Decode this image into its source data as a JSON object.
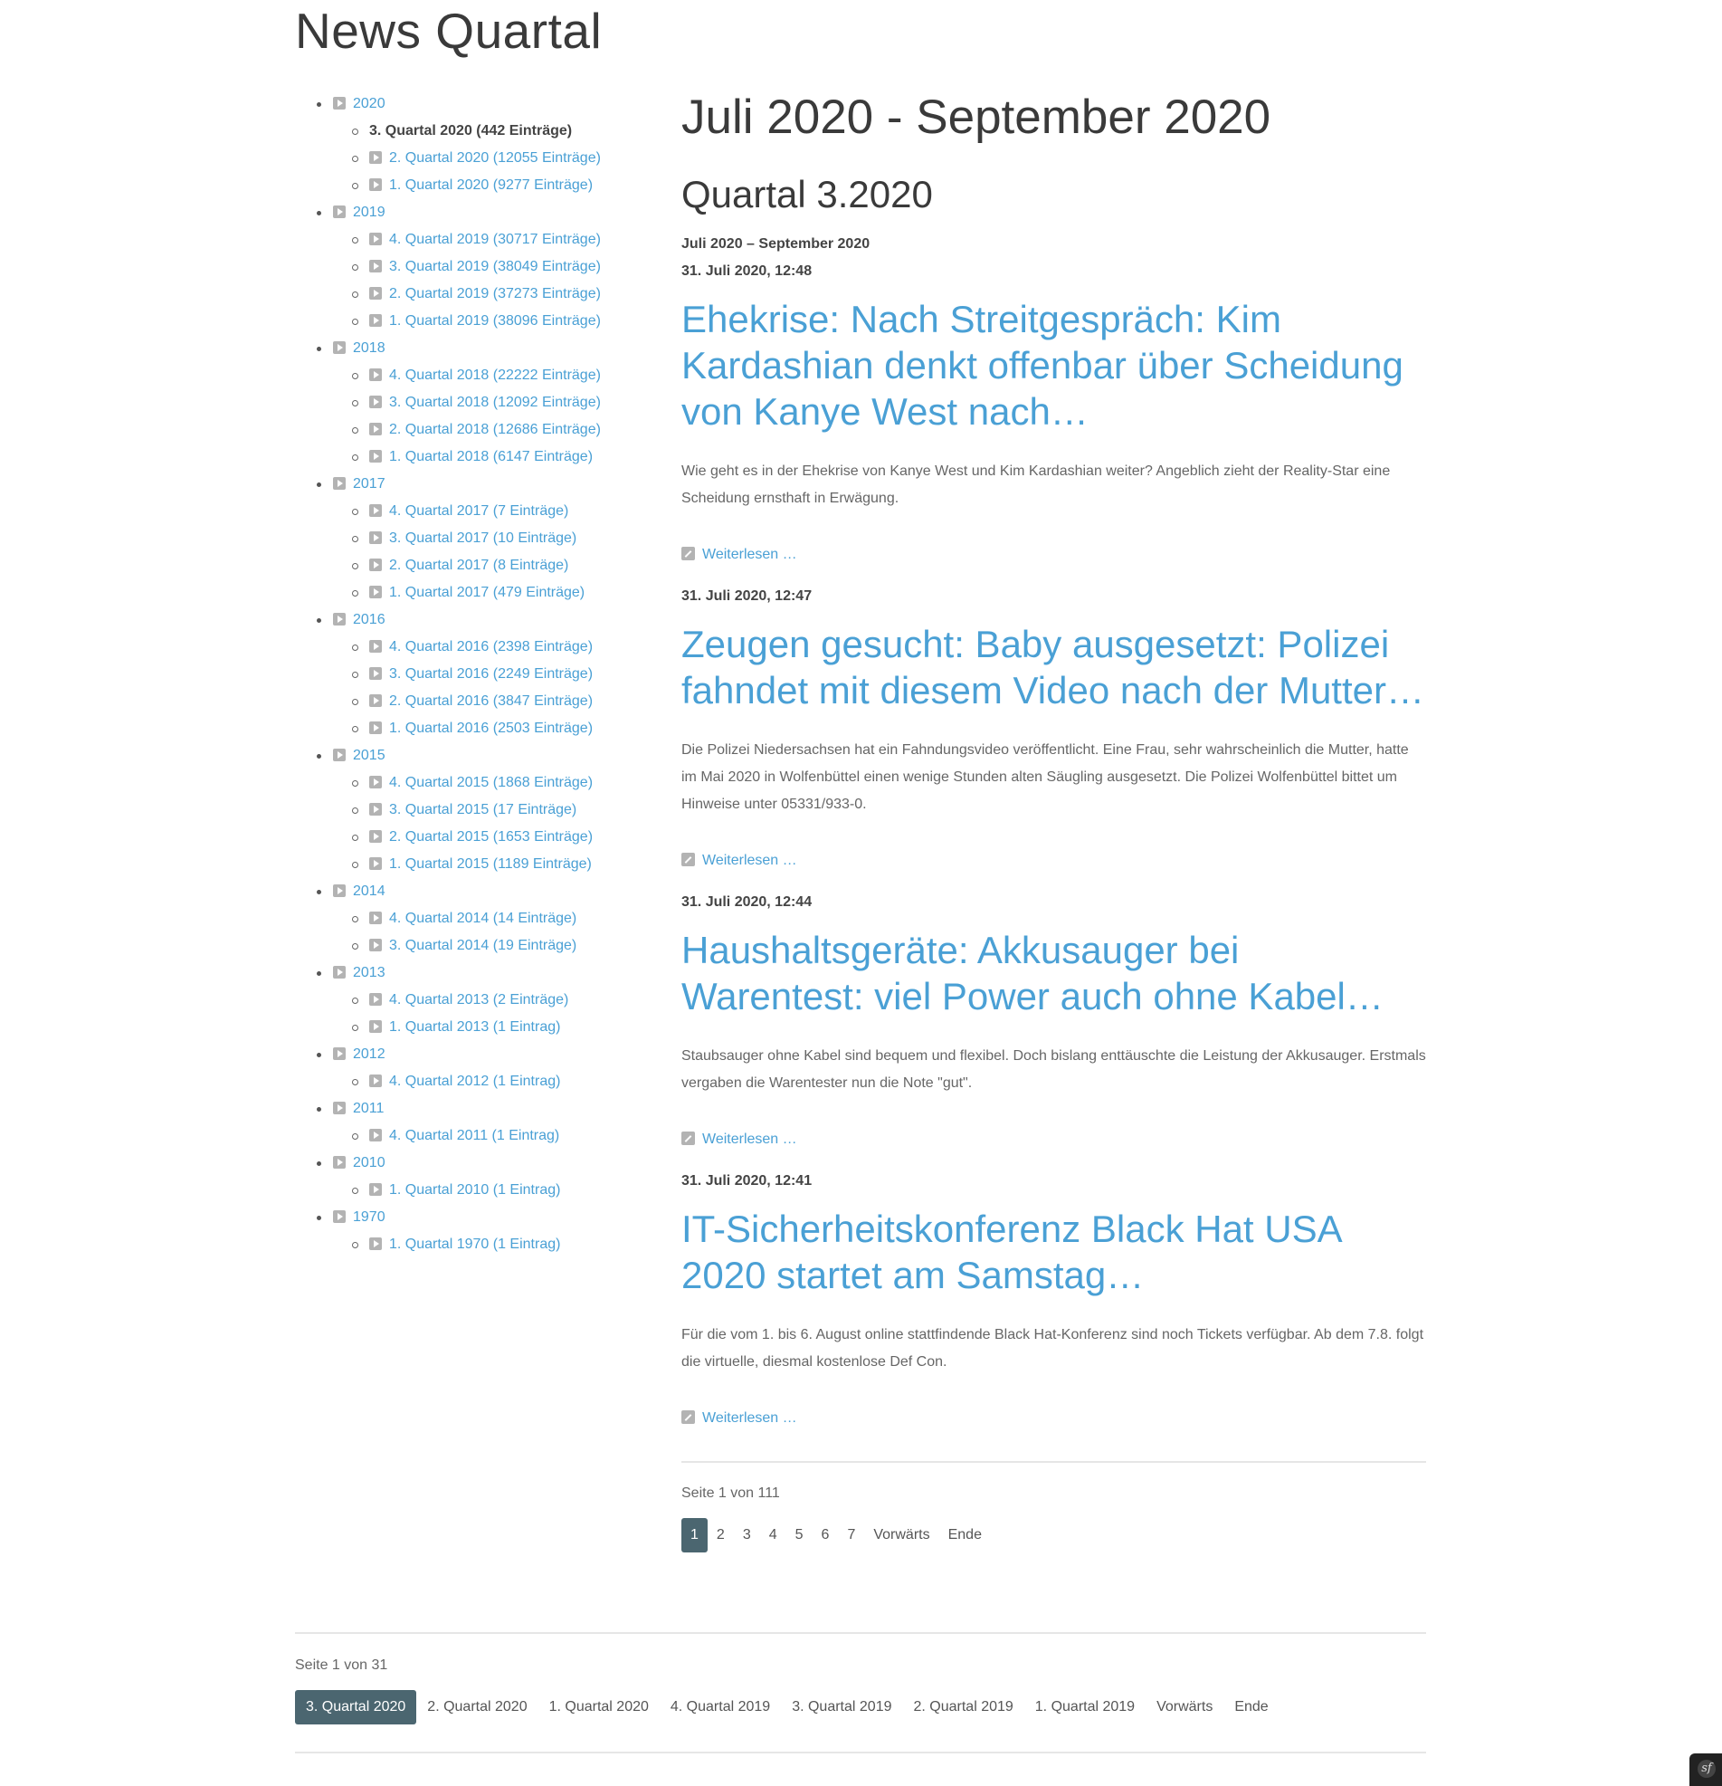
{
  "site_title": "News Quartal",
  "sidebar": {
    "years": [
      {
        "label": "2020",
        "quarters": [
          {
            "label": "3. Quartal 2020 (442 Einträge)",
            "current": true
          },
          {
            "label": "2. Quartal 2020 (12055 Einträge)"
          },
          {
            "label": "1. Quartal 2020 (9277 Einträge)"
          }
        ]
      },
      {
        "label": "2019",
        "quarters": [
          {
            "label": "4. Quartal 2019 (30717 Einträge)"
          },
          {
            "label": "3. Quartal 2019 (38049 Einträge)"
          },
          {
            "label": "2. Quartal 2019 (37273 Einträge)"
          },
          {
            "label": "1. Quartal 2019 (38096 Einträge)"
          }
        ]
      },
      {
        "label": "2018",
        "quarters": [
          {
            "label": "4. Quartal 2018 (22222 Einträge)"
          },
          {
            "label": "3. Quartal 2018 (12092 Einträge)"
          },
          {
            "label": "2. Quartal 2018 (12686 Einträge)"
          },
          {
            "label": "1. Quartal 2018 (6147 Einträge)"
          }
        ]
      },
      {
        "label": "2017",
        "quarters": [
          {
            "label": "4. Quartal 2017 (7 Einträge)"
          },
          {
            "label": "3. Quartal 2017 (10 Einträge)"
          },
          {
            "label": "2. Quartal 2017 (8 Einträge)"
          },
          {
            "label": "1. Quartal 2017 (479 Einträge)"
          }
        ]
      },
      {
        "label": "2016",
        "quarters": [
          {
            "label": "4. Quartal 2016 (2398 Einträge)"
          },
          {
            "label": "3. Quartal 2016 (2249 Einträge)"
          },
          {
            "label": "2. Quartal 2016 (3847 Einträge)"
          },
          {
            "label": "1. Quartal 2016 (2503 Einträge)"
          }
        ]
      },
      {
        "label": "2015",
        "quarters": [
          {
            "label": "4. Quartal 2015 (1868 Einträge)"
          },
          {
            "label": "3. Quartal 2015 (17 Einträge)"
          },
          {
            "label": "2. Quartal 2015 (1653 Einträge)"
          },
          {
            "label": "1. Quartal 2015 (1189 Einträge)"
          }
        ]
      },
      {
        "label": "2014",
        "quarters": [
          {
            "label": "4. Quartal 2014 (14 Einträge)"
          },
          {
            "label": "3. Quartal 2014 (19 Einträge)"
          }
        ]
      },
      {
        "label": "2013",
        "quarters": [
          {
            "label": "4. Quartal 2013 (2 Einträge)"
          },
          {
            "label": "1. Quartal 2013 (1 Eintrag)"
          }
        ]
      },
      {
        "label": "2012",
        "quarters": [
          {
            "label": "4. Quartal 2012 (1 Eintrag)"
          }
        ]
      },
      {
        "label": "2011",
        "quarters": [
          {
            "label": "4. Quartal 2011 (1 Eintrag)"
          }
        ]
      },
      {
        "label": "2010",
        "quarters": [
          {
            "label": "1. Quartal 2010 (1 Eintrag)"
          }
        ]
      },
      {
        "label": "1970",
        "quarters": [
          {
            "label": "1. Quartal 1970 (1 Eintrag)"
          }
        ]
      }
    ]
  },
  "main": {
    "heading": "Juli 2020 - September 2020",
    "subheading": "Quartal 3.2020",
    "range": "Juli 2020 – September 2020",
    "read_more": "Weiterlesen …",
    "articles": [
      {
        "date": "31. Juli 2020, 12:48",
        "headline": "Ehekrise: Nach Streitgespräch: Kim Kardashian denkt offenbar über Scheidung von Kanye West nach…",
        "teaser": "Wie geht es in der Ehekrise von Kanye West und Kim Kardashian weiter? Angeblich zieht der Reality-Star eine Scheidung ernsthaft in Erwägung."
      },
      {
        "date": "31. Juli 2020, 12:47",
        "headline": "Zeugen gesucht: Baby ausgesetzt: Polizei fahndet mit diesem Video nach der Mutter…",
        "teaser": "Die Polizei Niedersachsen hat ein Fahndungsvideo veröffentlicht. Eine Frau, sehr wahrscheinlich die Mutter, hatte im Mai 2020 in Wolfenbüttel einen wenige Stunden alten Säugling ausgesetzt. Die Polizei Wolfenbüttel bittet um Hinweise unter 05331/933-0."
      },
      {
        "date": "31. Juli 2020, 12:44",
        "headline": "Haushaltsgeräte: Akkusauger bei Warentest: viel Power auch ohne Kabel…",
        "teaser": "Staubsauger ohne Kabel sind bequem und flexibel. Doch bislang enttäuschte die Leistung der Akkusauger. Erstmals vergaben die Warentester nun die Note \"gut\"."
      },
      {
        "date": "31. Juli 2020, 12:41",
        "headline": "IT-Sicherheitskonferenz Black Hat USA 2020 startet am Samstag…",
        "teaser": "Für die vom 1. bis 6. August online stattfindende Black Hat-Konferenz sind noch Tickets verfügbar. Ab dem 7.8. folgt die virtuelle, diesmal kostenlose Def Con."
      }
    ],
    "pagination": {
      "info": "Seite 1 von 111",
      "pages": [
        "1",
        "2",
        "3",
        "4",
        "5",
        "6",
        "7"
      ],
      "next": "Vorwärts",
      "last": "Ende"
    }
  },
  "footer_pagination": {
    "info": "Seite 1 von 31",
    "pages": [
      "3. Quartal 2020",
      "2. Quartal 2020",
      "1. Quartal 2020",
      "4. Quartal 2019",
      "3. Quartal 2019",
      "2. Quartal 2019",
      "1. Quartal 2019"
    ],
    "next": "Vorwärts",
    "last": "Ende"
  },
  "colors": {
    "link": "#4aa0d5",
    "active_page": "#4b6670",
    "heading": "#3a3a3a"
  }
}
